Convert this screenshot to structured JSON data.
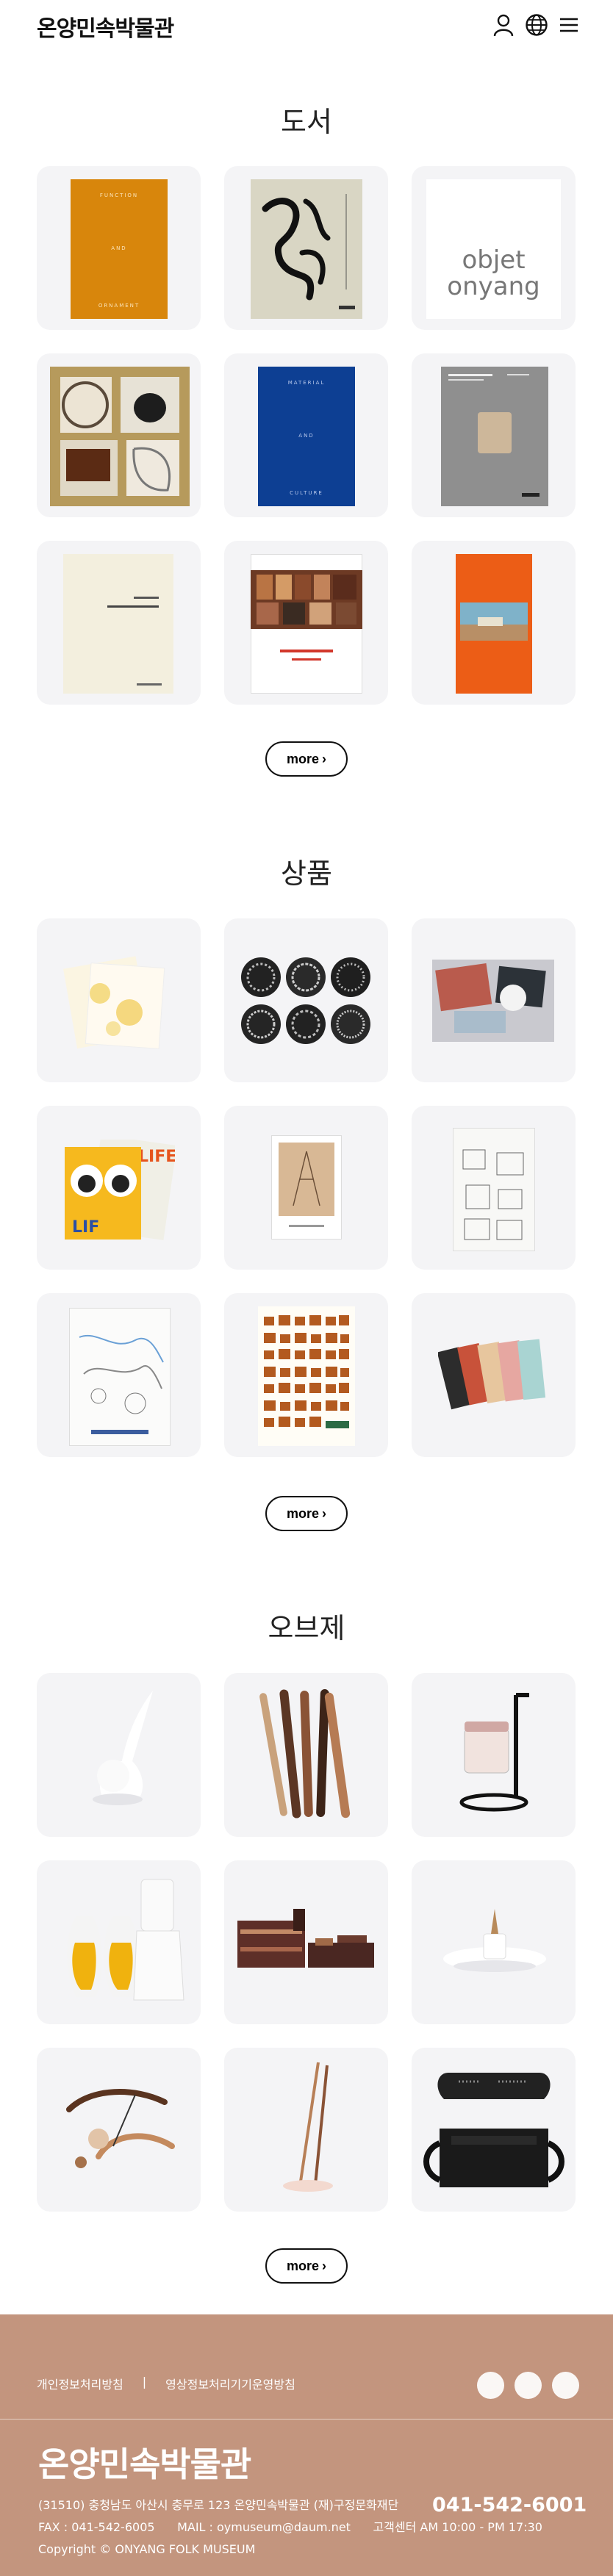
{
  "header": {
    "logo": "온양민속박물관",
    "icons": [
      "user-icon",
      "globe-icon",
      "menu-icon"
    ]
  },
  "sections": [
    {
      "title": "도서",
      "more_label": "more"
    },
    {
      "title": "상품",
      "more_label": "more"
    },
    {
      "title": "오브제",
      "more_label": "more"
    }
  ],
  "books": {
    "b1_line1": "FUNCTION",
    "b1_line2": "AND",
    "b1_line3": "ORNAMENT",
    "b3_line1": "objet",
    "b3_line2": "onyang",
    "b5_line1": "MATERIAL",
    "b5_line2": "AND",
    "b5_line3": "CULTURE"
  },
  "footer": {
    "links": [
      "개인정보처리방침",
      "영상정보처리기기운영방침"
    ],
    "separator": "|",
    "logo": "온양민속박물관",
    "address": "(31510) 충청남도 아산시 충무로 123 온양민속박물관 (재)구정문화재단",
    "phone": "041-542-6001",
    "fax": "FAX : 041-542-6005",
    "mail": "MAIL : oymuseum@daum.net",
    "hours": "고객센터 AM 10:00 - PM 17:30",
    "copyright": "Copyright © ONYANG FOLK MUSEUM"
  }
}
